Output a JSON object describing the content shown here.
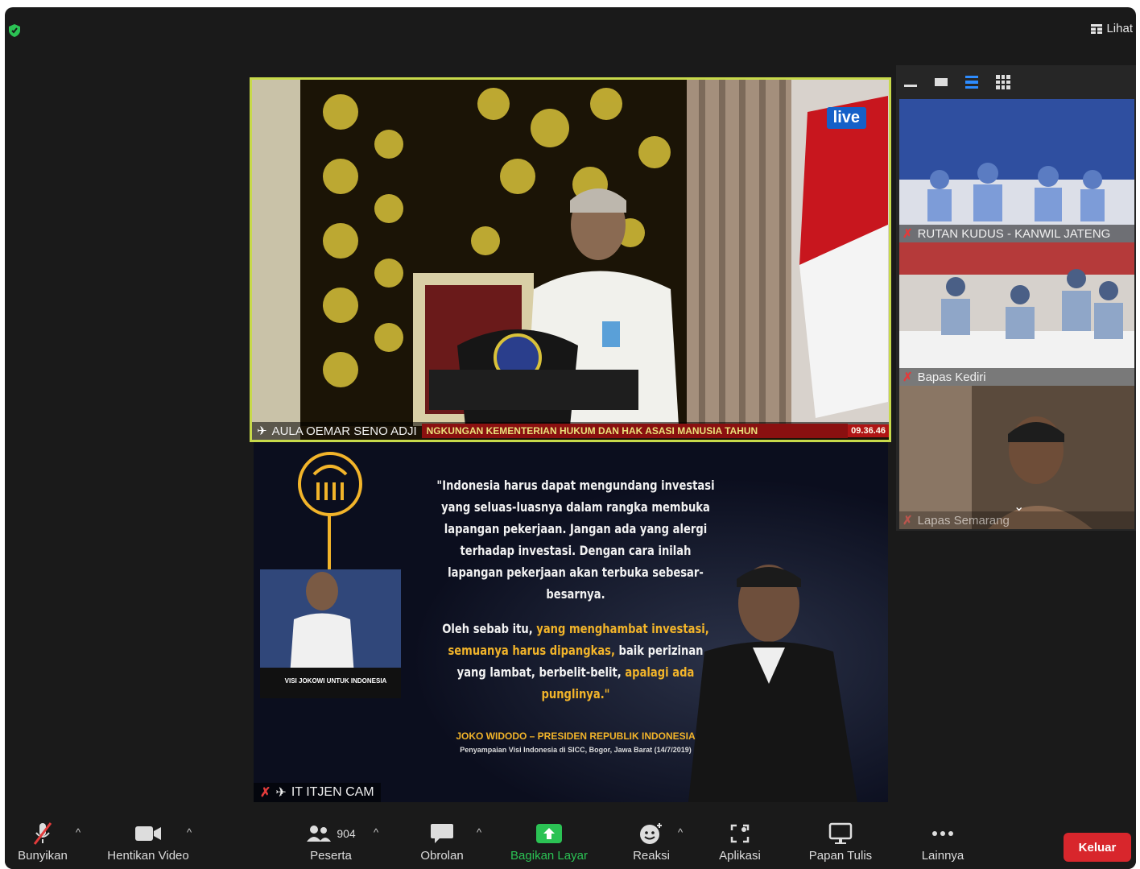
{
  "top": {
    "view_label": "Lihat"
  },
  "main_video": {
    "live_badge": "live",
    "speaker_name": "AULA OEMAR SENO ADJI",
    "ticker": "NGKUNGAN KEMENTERIAN HUKUM DAN HAK ASASI MANUSIA TAHUN",
    "clock": "09.36.46"
  },
  "share": {
    "quote_p1": "\"Indonesia harus dapat mengundang investasi yang seluas-luasnya dalam rangka membuka lapangan pekerjaan. Jangan ada yang alergi terhadap investasi. Dengan cara inilah lapangan pekerjaan akan terbuka sebesar-besarnya.",
    "quote_p2_a": "Oleh sebab itu, ",
    "quote_p2_b": "yang menghambat investasi, semuanya harus dipangkas,",
    "quote_p2_c": " baik perizinan yang lambat, berbelit-belit, ",
    "quote_p2_d": "apalagi ada punglinya.\"",
    "author": "JOKO WIDODO – PRESIDEN REPUBLIK INDONESIA",
    "source": "Penyampaian Visi Indonesia di SICC, Bogor, Jawa Barat (14/7/2019)",
    "inset_caption": "VISI JOKOWI UNTUK INDONESIA",
    "participant_name": "IT ITJEN CAM"
  },
  "gallery": {
    "tiles": [
      {
        "name": "RUTAN KUDUS - KANWIL JATENG"
      },
      {
        "name": "Bapas Kediri"
      },
      {
        "name": "Lapas Semarang"
      }
    ]
  },
  "toolbar": {
    "unmute": "Bunyikan",
    "stop_video": "Hentikan Video",
    "participants": "Peserta",
    "participant_count": "904",
    "chat": "Obrolan",
    "share": "Bagikan Layar",
    "reactions": "Reaksi",
    "apps": "Aplikasi",
    "whiteboard": "Papan Tulis",
    "more": "Lainnya",
    "leave": "Keluar"
  },
  "colors": {
    "share_green": "#2bc254",
    "leave_red": "#d8262c",
    "speaker_border": "#c7d94a"
  }
}
